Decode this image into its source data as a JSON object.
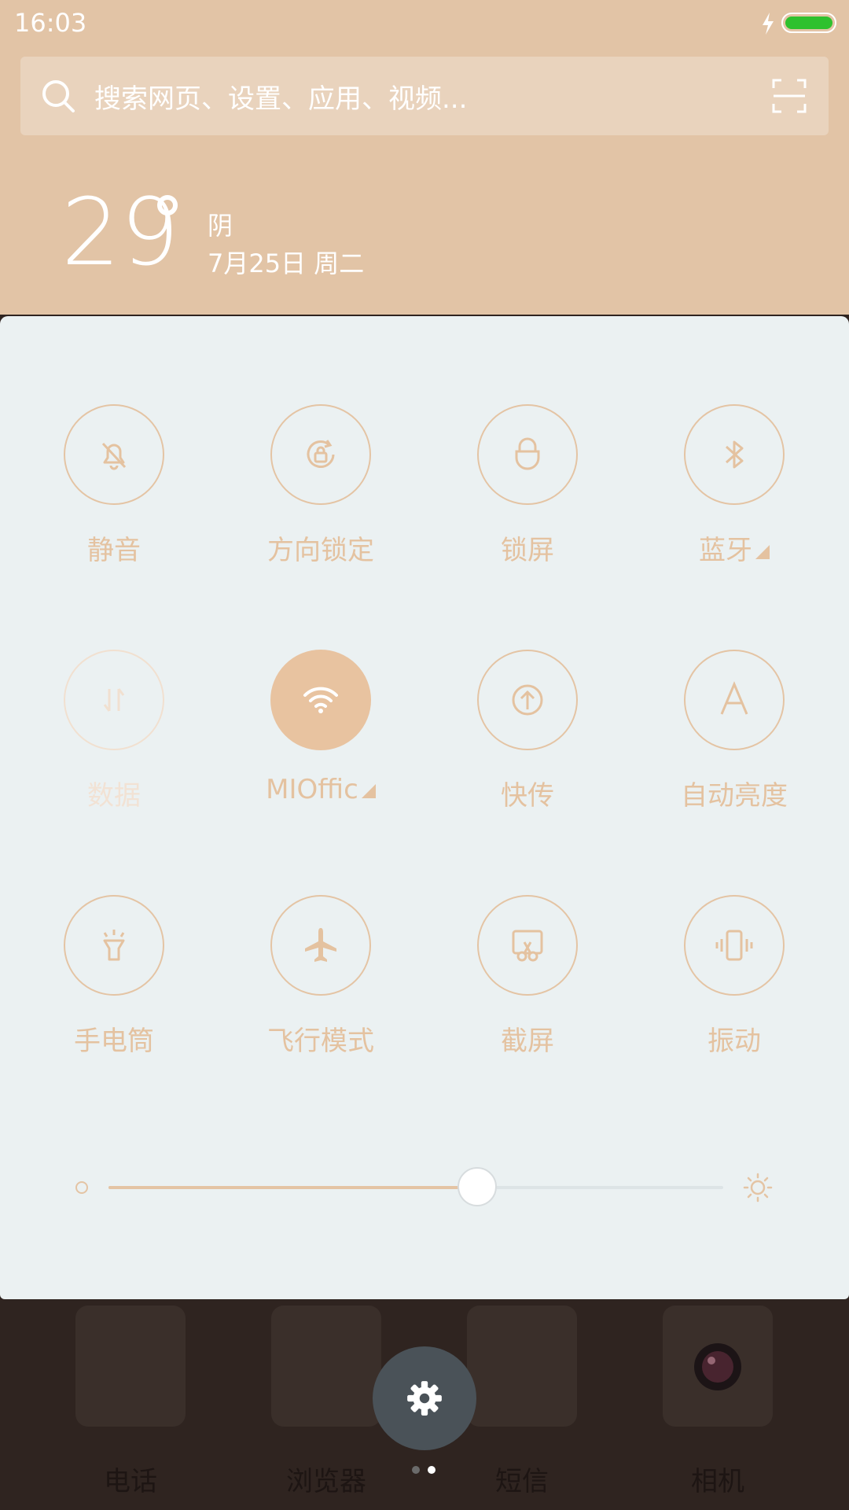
{
  "status_bar": {
    "time": "16:03",
    "battery_level": 1.0,
    "charging": true
  },
  "search": {
    "placeholder": "搜索网页、设置、应用、视频..."
  },
  "weather": {
    "temperature": "29",
    "condition": "阴",
    "date": "7月25日 周二"
  },
  "tiles": [
    {
      "label": "静音",
      "icon": "bell-off-icon",
      "state": "off"
    },
    {
      "label": "方向锁定",
      "icon": "rotation-lock-icon",
      "state": "off"
    },
    {
      "label": "锁屏",
      "icon": "lock-icon",
      "state": "off"
    },
    {
      "label": "蓝牙",
      "icon": "bluetooth-icon",
      "state": "off",
      "has_more": true
    },
    {
      "label": "数据",
      "icon": "data-arrows-icon",
      "state": "disabled"
    },
    {
      "label": "MIOffic",
      "icon": "wifi-icon",
      "state": "on",
      "has_more": true
    },
    {
      "label": "快传",
      "icon": "upload-circle-icon",
      "state": "off"
    },
    {
      "label": "自动亮度",
      "icon": "auto-brightness-icon",
      "state": "off"
    },
    {
      "label": "手电筒",
      "icon": "flashlight-icon",
      "state": "off"
    },
    {
      "label": "飞行模式",
      "icon": "airplane-icon",
      "state": "off"
    },
    {
      "label": "截屏",
      "icon": "screenshot-icon",
      "state": "off"
    },
    {
      "label": "振动",
      "icon": "vibrate-icon",
      "state": "off"
    }
  ],
  "brightness": {
    "level": 0.6
  },
  "dock": {
    "apps": [
      {
        "label": "电话",
        "icon": "phone-app-icon"
      },
      {
        "label": "浏览器",
        "icon": "browser-app-icon"
      },
      {
        "label": "短信",
        "icon": "messages-app-icon"
      },
      {
        "label": "相机",
        "icon": "camera-app-icon"
      }
    ]
  },
  "colors": {
    "accent": "#e4c2a0",
    "panel_bg": "#ebf1f2",
    "header_bg": "#e2c4a6",
    "battery": "#2ec12e"
  }
}
